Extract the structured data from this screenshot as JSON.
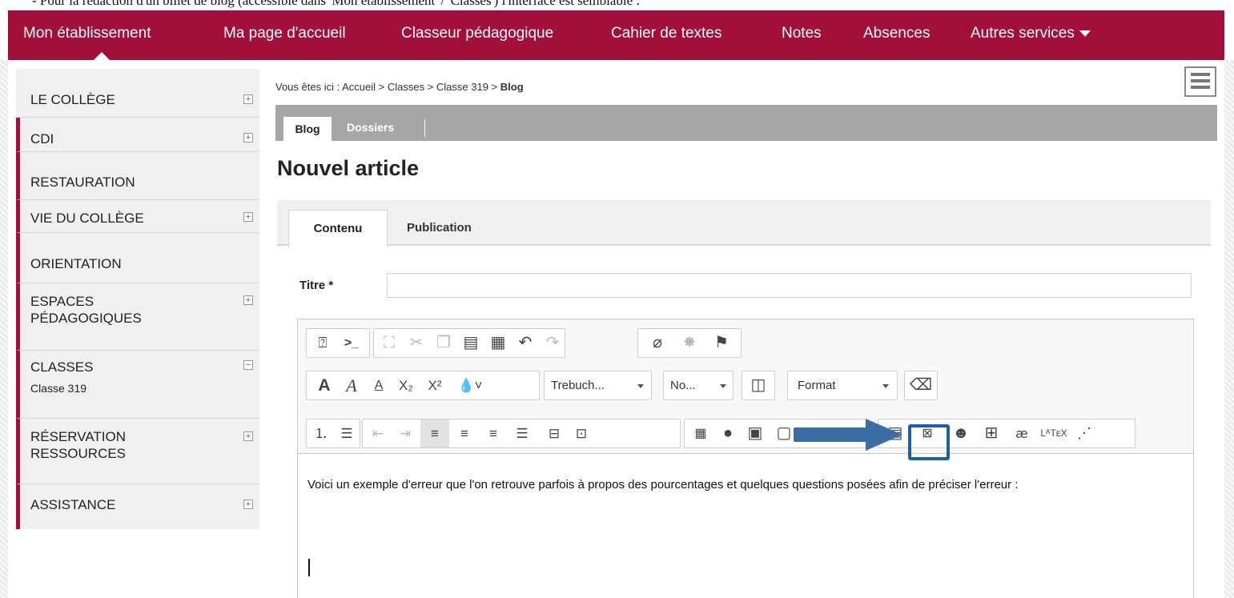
{
  "caption": "- Pour la rédaction d'un billet de blog (accessible dans 'Mon établissement' / 'Classes') l'interface est semblable :",
  "topnav": {
    "items": [
      "Mon établissement",
      "Ma page d'accueil",
      "Classeur pédagogique",
      "Cahier de textes",
      "Notes",
      "Absences",
      "Autres services"
    ]
  },
  "sidebar": {
    "items": [
      {
        "label": "LE COLLÈGE",
        "toggle": "+"
      },
      {
        "label": "CDI",
        "toggle": "+"
      },
      {
        "label": "RESTAURATION"
      },
      {
        "label": "VIE DU COLLÈGE",
        "toggle": "+"
      },
      {
        "label": "ORIENTATION"
      },
      {
        "label": "ESPACES PÉDAGOGIQUES",
        "toggle": "+"
      },
      {
        "label": "CLASSES",
        "toggle": "−",
        "sub": "Classe 319"
      },
      {
        "label": "RÉSERVATION RESSOURCES",
        "toggle": "+"
      },
      {
        "label": "ASSISTANCE",
        "toggle": "+"
      }
    ]
  },
  "breadcrumb": {
    "prefix": "Vous êtes ici : ",
    "path": "Accueil > Classes > Classe 319 > ",
    "current": "Blog"
  },
  "tabs_top": [
    "Blog",
    "Dossiers"
  ],
  "page_title": "Nouvel article",
  "tabs_article": [
    "Contenu",
    "Publication"
  ],
  "form": {
    "titre_label": "Titre *",
    "titre_value": ""
  },
  "toolbar": {
    "font_combo": "Trebuch...",
    "size_combo": "No...",
    "format_combo": "Format"
  },
  "content": {
    "text": "Voici un exemple d'erreur que l'on retrouve parfois à propos des pourcentages et quelques questions posées afin de préciser l'erreur :"
  },
  "colors": {
    "brand": "#a20f38",
    "annotation": "#1f5fa8"
  }
}
